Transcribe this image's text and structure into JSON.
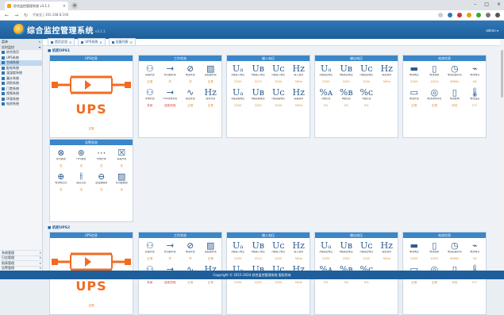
{
  "browser": {
    "tab_title": "综合监控管理系统 v3.1.1",
    "url": "不安全 | 192.168.8.100",
    "new_tab": "+"
  },
  "app": {
    "title": "综合监控管理系统",
    "version": "v3.1.1",
    "user": "admin ▾"
  },
  "sidebar": {
    "header": "菜单",
    "header_toggle": "«",
    "section": "实时监控",
    "items": [
      {
        "label": "综合首页",
        "active": false
      },
      {
        "label": "UPS系统",
        "active": false
      },
      {
        "label": "空调系统",
        "active": true
      },
      {
        "label": "配电系统",
        "active": false
      },
      {
        "label": "温湿度系统",
        "active": false
      },
      {
        "label": "漏水系统",
        "active": false
      },
      {
        "label": "消防系统",
        "active": false
      },
      {
        "label": "门禁系统",
        "active": false
      },
      {
        "label": "视频系统",
        "active": false
      },
      {
        "label": "环境系统",
        "active": false
      },
      {
        "label": "电池系统",
        "active": false
      }
    ],
    "bottom": [
      {
        "label": "系统管理"
      },
      {
        "label": "日志管理"
      },
      {
        "label": "报表管理"
      },
      {
        "label": "告警管理"
      }
    ]
  },
  "breadcrumbs": [
    {
      "label": "首页总览"
    },
    {
      "label": "UPS系统"
    },
    {
      "label": "设备列表"
    }
  ],
  "sections": [
    {
      "title": "■ 机柜UPS1"
    },
    {
      "title": "■ 机柜UPS2"
    }
  ],
  "ups": {
    "label": "UPS",
    "status": "正常"
  },
  "panels": {
    "ups_head": "UPS信息",
    "work": {
      "title": "工作状态",
      "cells": [
        {
          "sym": "⚇",
          "lab": "旁路状态",
          "val": "正常"
        },
        {
          "sym": "⇥",
          "lab": "整流器状态",
          "val": "开"
        },
        {
          "sym": "⊘",
          "lab": "电池状态",
          "val": "开"
        },
        {
          "sym": "▨",
          "lab": "逆变器状态",
          "val": "正常"
        },
        {
          "sym": "⚇",
          "lab": "市电状态",
          "val": "关闭",
          "red": true
        },
        {
          "sym": "⇥",
          "lab": "UPS供电状态",
          "val": "逆变供电",
          "red": true
        },
        {
          "sym": "∿",
          "lab": "输出状态",
          "val": "正常"
        },
        {
          "sym": "Hz",
          "lab": "频率状态",
          "val": "正常"
        }
      ]
    },
    "input": {
      "title": "输入电压",
      "cells": [
        {
          "sym": "Uₐ",
          "lab": "A相输入电压",
          "val": "220V"
        },
        {
          "sym": "Uʙ",
          "lab": "B相输入电压",
          "val": "221V"
        },
        {
          "sym": "Uᴄ",
          "lab": "C相输入电压",
          "val": "220V"
        },
        {
          "sym": "Hz",
          "lab": "输入频率",
          "val": "50Hz"
        },
        {
          "sym": "Uₐ",
          "lab": "A相旁路电压",
          "val": "220V"
        },
        {
          "sym": "Uʙ",
          "lab": "B相旁路电压",
          "val": "222V"
        },
        {
          "sym": "Uᴄ",
          "lab": "C相旁路电压",
          "val": "220V"
        },
        {
          "sym": "Hz",
          "lab": "旁路频率",
          "val": "50Hz"
        }
      ]
    },
    "output": {
      "title": "输出电压",
      "cells": [
        {
          "sym": "Uₐ",
          "lab": "A相输出电压",
          "val": "220V"
        },
        {
          "sym": "Uʙ",
          "lab": "B相输出电压",
          "val": "220V"
        },
        {
          "sym": "Uᴄ",
          "lab": "C相输出电压",
          "val": "220V"
        },
        {
          "sym": "Hz",
          "lab": "输出频率",
          "val": "50Hz"
        },
        {
          "sym": "%ᴀ",
          "lab": "A相负载",
          "val": "0%"
        },
        {
          "sym": "%ʙ",
          "lab": "B相负载",
          "val": "0%"
        },
        {
          "sym": "%ᴄ",
          "lab": "C相负载",
          "val": "0%"
        },
        {
          "sym": "",
          "lab": "",
          "val": ""
        }
      ]
    },
    "battery": {
      "title": "电池信息",
      "cells": [
        {
          "sym": "▬",
          "lab": "电池电压",
          "val": "200V"
        },
        {
          "sym": "▯",
          "lab": "电池容量",
          "val": "100%"
        },
        {
          "sym": "◷",
          "lab": "电池后备时间",
          "val": "60Min"
        },
        {
          "sym": "⌁",
          "lab": "电池电流",
          "val": "0A"
        },
        {
          "sym": "▭",
          "lab": "电池状态",
          "val": "正常"
        },
        {
          "sym": "◎",
          "lab": "电池充电状态",
          "val": "正常"
        },
        {
          "sym": "▯",
          "lab": "电池放电",
          "val": "浮充"
        },
        {
          "sym": "🌡",
          "lab": "电池温度",
          "val": "0°C"
        }
      ]
    },
    "alarm": {
      "title": "告警状态",
      "cells": [
        {
          "sym": "⊗",
          "lab": "通讯故障",
          "val": "无"
        },
        {
          "sym": "⊚",
          "lab": "UPS故障",
          "val": "无"
        },
        {
          "sym": "⋯",
          "lab": "市电异常",
          "val": "无"
        },
        {
          "sym": "☒",
          "lab": "旁路异常",
          "val": "无"
        },
        {
          "sym": "⊕",
          "lab": "电池电压低",
          "val": "无"
        },
        {
          "sym": "⫲",
          "lab": "输出过载",
          "val": "无"
        },
        {
          "sym": "⊖",
          "lab": "逆变器故障",
          "val": "无"
        },
        {
          "sym": "▨",
          "lab": "整流器故障",
          "val": "无"
        }
      ]
    }
  },
  "footer": "Copyright © 2015-2024 综合监控管理系统 版权所有"
}
